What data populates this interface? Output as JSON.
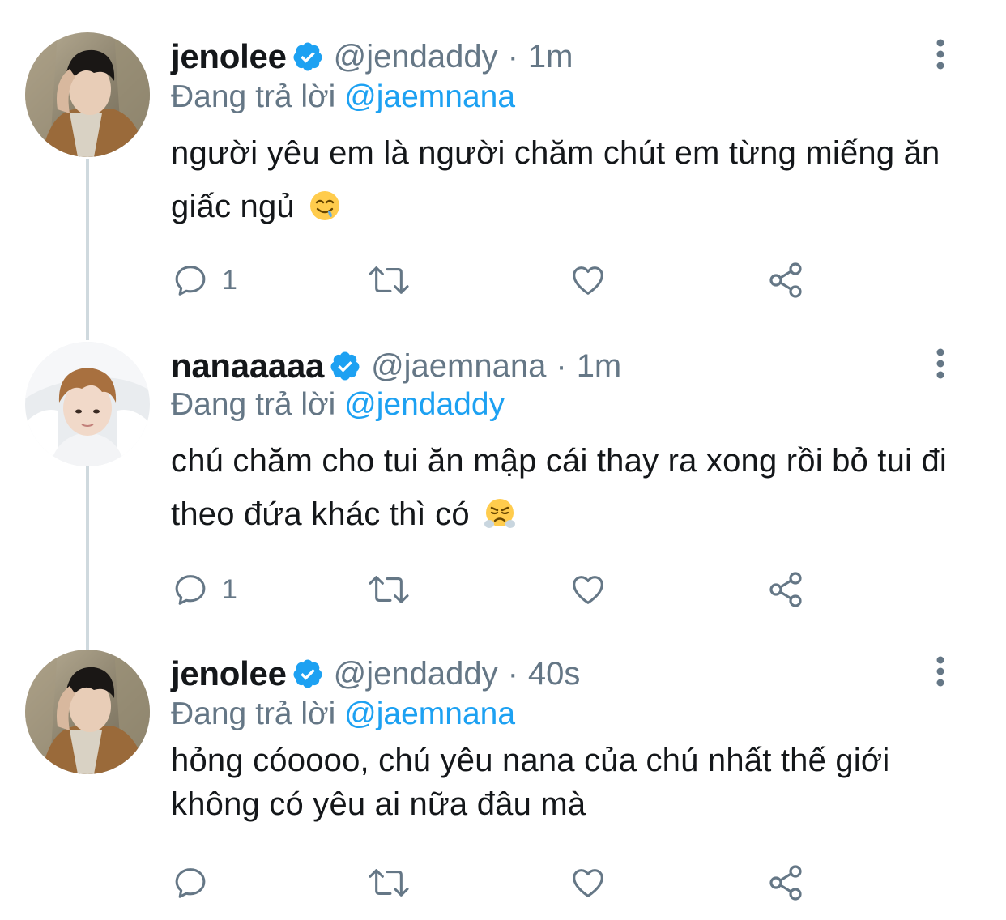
{
  "colors": {
    "text": "#14171a",
    "muted": "#657786",
    "accent": "#1da1f2",
    "thread_line": "#cfd9de"
  },
  "reply_prefix": "Đang trả lời",
  "tweets": [
    {
      "display_name": "jenolee",
      "verified": true,
      "handle": "@jendaddy",
      "separator": "·",
      "time": "1m",
      "reply_to": "@jaemnana",
      "text": "người yêu em là người chăm chút em từng miếng ăn giấc ngủ",
      "emoji": "drooling-face",
      "reply_count": "1",
      "avatar": "avatar-jenolee"
    },
    {
      "display_name": "nanaaaaa",
      "verified": true,
      "handle": "@jaemnana",
      "separator": "·",
      "time": "1m",
      "reply_to": "@jendaddy",
      "text": "chú chăm cho tui ăn mập cái thay ra xong rồi bỏ tui đi theo đứa khác thì có",
      "emoji": "face-with-steam-from-nose",
      "reply_count": "1",
      "avatar": "avatar-nanaaaaa"
    },
    {
      "display_name": "jenolee",
      "verified": true,
      "handle": "@jendaddy",
      "separator": "·",
      "time": "40s",
      "reply_to": "@jaemnana",
      "text": "hỏng cóoooo, chú yêu nana của chú nhất thế giới không có yêu ai nữa đâu mà",
      "emoji": "",
      "reply_count": "",
      "avatar": "avatar-jenolee"
    }
  ],
  "icons": {
    "reply": "speech-bubble-icon",
    "retweet": "retweet-arrows-icon",
    "like": "heart-icon",
    "share": "share-nodes-icon",
    "more": "vertical-ellipsis-icon",
    "verified": "verified-badge-icon"
  }
}
